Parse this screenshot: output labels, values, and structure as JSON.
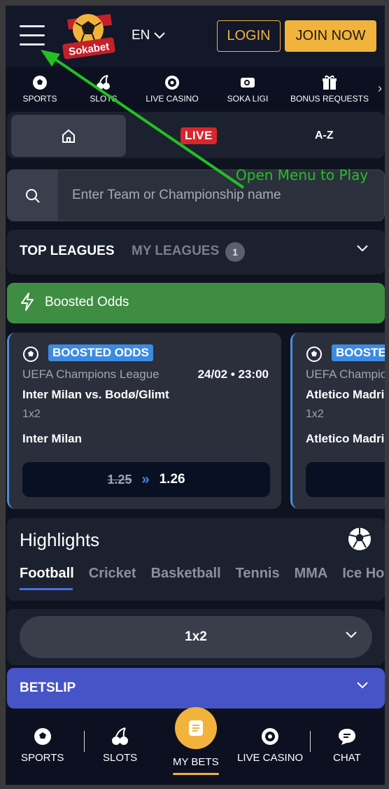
{
  "header": {
    "brand": "Sokabet",
    "language": "EN",
    "login_label": "LOGIN",
    "join_label": "JOIN NOW"
  },
  "category_nav": {
    "items": [
      {
        "label": "SPORTS",
        "icon": "soccer-ball-icon"
      },
      {
        "label": "SLOTS",
        "icon": "cherries-icon"
      },
      {
        "label": "LIVE CASINO",
        "icon": "roulette-icon"
      },
      {
        "label": "SOKA LIGI",
        "icon": "ticket-icon"
      },
      {
        "label": "BONUS REQUESTS",
        "icon": "gift-icon"
      }
    ]
  },
  "tabs": {
    "home_icon": "home-icon",
    "live_label": "LIVE",
    "az_label": "A-Z"
  },
  "search": {
    "placeholder": "Enter Team or Championship name"
  },
  "leagues": {
    "top_label": "TOP LEAGUES",
    "my_label": "MY LEAGUES",
    "my_count": "1"
  },
  "boosted_banner": {
    "label": "Boosted Odds"
  },
  "boost_cards": [
    {
      "badge": "BOOSTED ODDS",
      "league": "UEFA Champions League",
      "datetime": "24/02 • 23:00",
      "match": "Inter Milan vs. Bodø/Glimt",
      "market": "1x2",
      "selection": "Inter Milan",
      "old_odds": "1.25",
      "arrow": "»",
      "new_odds": "1.26"
    },
    {
      "badge": "BOOSTED ODDS",
      "league": "UEFA Champions League",
      "datetime": "",
      "match": "Atletico Madrid",
      "market": "1x2",
      "selection": "Atletico Madrid",
      "old_odds": "",
      "arrow": "",
      "new_odds": ""
    }
  ],
  "highlights": {
    "title": "Highlights",
    "sports": [
      "Football",
      "Cricket",
      "Basketball",
      "Tennis",
      "MMA",
      "Ice Hockey"
    ]
  },
  "market_select": {
    "value": "1x2"
  },
  "betslip": {
    "label": "BETSLIP"
  },
  "bottom_nav": {
    "sports": "SPORTS",
    "slots": "SLOTS",
    "my_bets": "MY BETS",
    "live_casino": "LIVE CASINO",
    "chat": "CHAT"
  },
  "annotation": {
    "text": "Open Menu to Play",
    "color": "#22c022"
  },
  "colors": {
    "accent": "#f2b33d",
    "live": "#d8262d",
    "boost_green": "#3f8d43",
    "betslip_blue": "#4654c7",
    "badge_blue": "#3d8be0"
  }
}
